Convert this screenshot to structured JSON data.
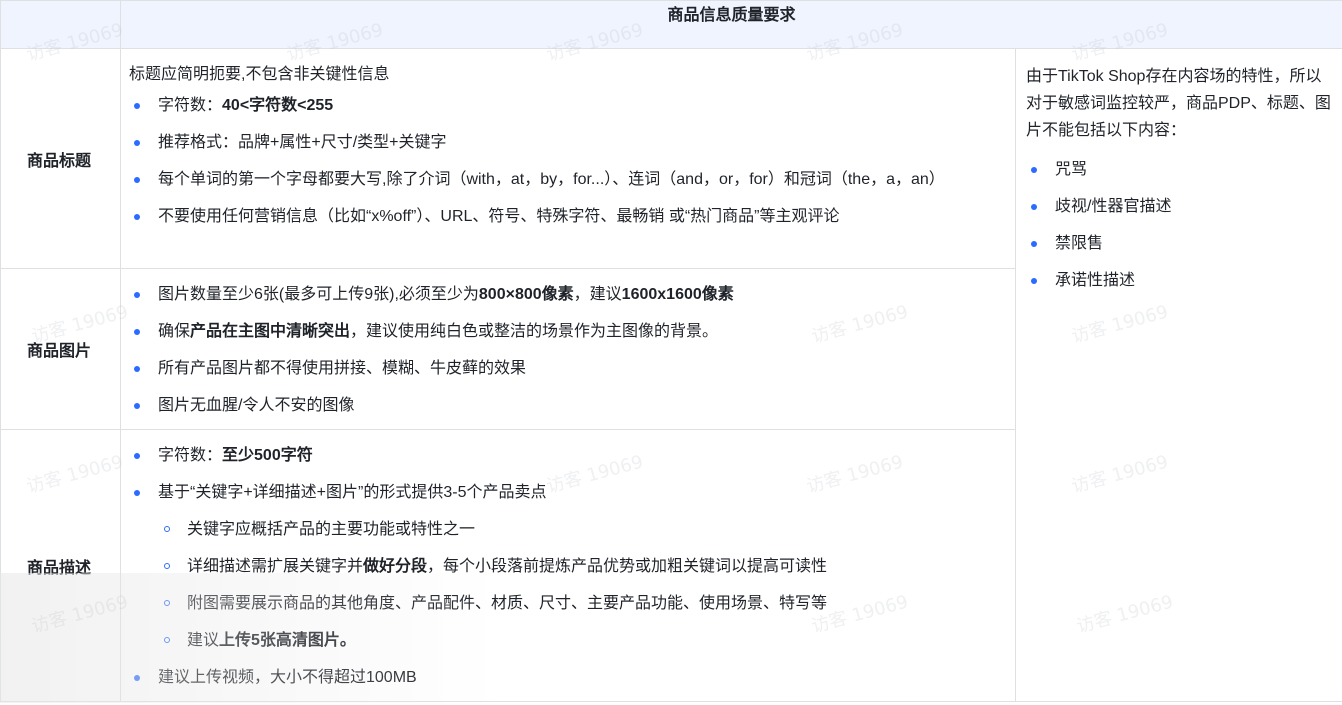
{
  "table": {
    "header": "商品信息质量要求",
    "title_row": {
      "label": "商品标题",
      "intro": "标题应简明扼要,不包含非关键性信息",
      "items": [
        {
          "plain": "字符数：",
          "bold": "40<字符数<255",
          "after": ""
        },
        {
          "plain": "推荐格式：品牌+属性+尺寸/类型+关键字",
          "bold": "",
          "after": ""
        },
        {
          "plain": "每个单词的第一个字母都要大写,除了介词（with，at，by，for...）、连词（and，or，for）和冠词（the，a，an）",
          "bold": "",
          "after": ""
        },
        {
          "plain": "不要使用任何营销信息（比如“x%off”）、URL、符号、特殊字符、最畅销 或“热门商品”等主观评论",
          "bold": "",
          "after": ""
        }
      ]
    },
    "image_row": {
      "label": "商品图片",
      "items": [
        {
          "plain": "图片数量至少6张(最多可上传9张),必须至少为",
          "bold": "800×800像素",
          "mid": "，建议",
          "bold2": "1600x1600像素"
        },
        {
          "plain": "确保",
          "bold": "产品在主图中清晰突出",
          "after": "，建议使用纯白色或整洁的场景作为主图像的背景。"
        },
        {
          "plain": "所有产品图片都不得使用拼接、模糊、牛皮藓的效果"
        },
        {
          "plain": "图片无血腥/令人不安的图像"
        }
      ]
    },
    "desc_row": {
      "label": "商品描述",
      "items": [
        {
          "plain": "字符数：",
          "bold": "至少500字符"
        },
        {
          "plain": "基于“关键字+详细描述+图片”的形式提供3-5个产品卖点"
        },
        {
          "plain": "关键字应概括产品的主要功能或特性之一"
        },
        {
          "plain": "详细描述需扩展关键字并",
          "bold": "做好分段",
          "after": "，每个小段落前提炼产品优势或加粗关键词以提高可读性"
        },
        {
          "plain": "附图需要展示商品的其他角度、产品配件、材质、尺寸、主要产品功能、使用场景、特写等"
        },
        {
          "plain": "建议",
          "bold": "上传5张高清图片。"
        },
        {
          "plain": "建议上传视频，大小不得超过100MB"
        }
      ]
    },
    "side": {
      "intro": "由于TikTok Shop存在内容场的特性，所以对于敏感词监控较严，商品PDP、标题、图片不能包括以下内容：",
      "items": [
        "咒骂",
        "歧视/性器官描述",
        "禁限售",
        "承诺性描述"
      ]
    }
  },
  "watermark": "访客 19069"
}
